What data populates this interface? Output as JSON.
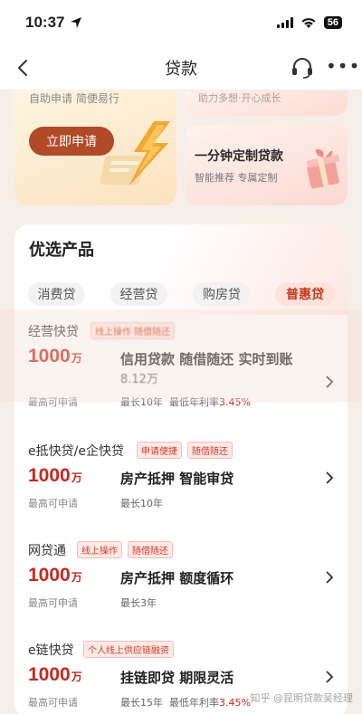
{
  "status": {
    "time": "10:37",
    "battery": "56"
  },
  "nav": {
    "title": "贷款"
  },
  "promo_left": {
    "subtitle": "自助申请 简便易行",
    "button": "立即申请"
  },
  "promo_right_top": {
    "text": "助力多想·开心成长"
  },
  "promo_right": {
    "title": "一分钟定制贷款",
    "subtitle": "智能推荐 专属定制"
  },
  "products_section": {
    "title": "优选产品",
    "tabs": [
      {
        "label": "消费贷"
      },
      {
        "label": "经营贷"
      },
      {
        "label": "购房贷"
      },
      {
        "label": "普惠贷"
      }
    ]
  },
  "products": [
    {
      "name": "经营快贷",
      "tags": [
        "线上操作 随借随还"
      ],
      "amount": "1000",
      "unit": "万",
      "amount_note": "最高可申请",
      "feature": "信用贷款 随借随还 实时到账",
      "feature2": "8.12万",
      "term": "最长10年",
      "rate_label": "最低年利率",
      "rate": "3.45%"
    },
    {
      "name": "e抵快贷/e企快贷",
      "tags": [
        "申请便捷",
        "随借随还"
      ],
      "amount": "1000",
      "unit": "万",
      "amount_note": "最高可申请",
      "feature": "房产抵押 智能审贷",
      "term": "最长10年"
    },
    {
      "name": "网贷通",
      "tags": [
        "线上操作",
        "随借随还"
      ],
      "amount": "1000",
      "unit": "万",
      "amount_note": "最高可申请",
      "feature": "房产抵押 额度循环",
      "term": "最长3年"
    },
    {
      "name": "e链快贷",
      "tags": [
        "个人线上供应链融资"
      ],
      "amount": "1000",
      "unit": "万",
      "amount_note": "最高可申请",
      "feature": "挂链即贷 期限灵活",
      "term": "最长15年",
      "rate_label": "最低年利率",
      "rate": "3.45%"
    }
  ],
  "watermark": "知乎 @昆明贷款吴经理",
  "colors": {
    "accent": "#c8281e",
    "apply_button": "#b14a27",
    "tag_text": "#d33c2a"
  }
}
